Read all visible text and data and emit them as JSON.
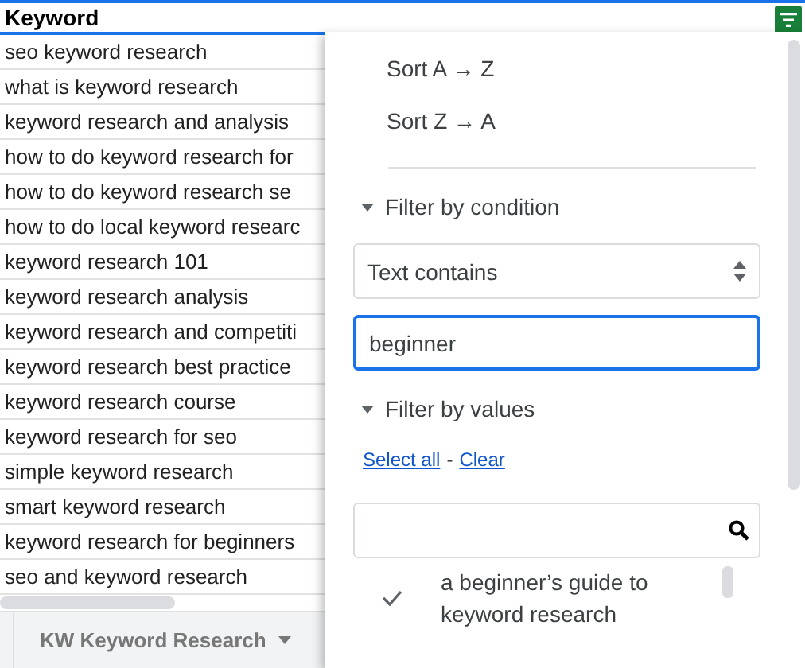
{
  "header": {
    "label": "Keyword"
  },
  "rows": [
    "seo keyword research",
    "what is keyword research",
    "keyword research and analysis",
    "how to do keyword research for",
    "how to do keyword research se",
    "how to do local keyword researc",
    "keyword research 101",
    "keyword research analysis",
    "keyword research and competiti",
    "keyword research best practice",
    "keyword research course",
    "keyword research for seo",
    "simple keyword research",
    "smart keyword research",
    "keyword research for beginners",
    "seo and keyword research"
  ],
  "sheet_tab": {
    "label": "KW Keyword Research"
  },
  "menu": {
    "sort_options": [
      "Sort A → Z",
      "Sort Z → A"
    ],
    "condition_section": {
      "label": "Filter by condition",
      "expanded": true,
      "condition": "Text contains",
      "value": "beginner"
    },
    "values_section": {
      "label": "Filter by values",
      "expanded": true,
      "select_all": "Select all",
      "separator": "-",
      "clear": "Clear",
      "values": [
        {
          "label": "a beginner’s guide to keyword research",
          "checked": true
        }
      ]
    }
  }
}
